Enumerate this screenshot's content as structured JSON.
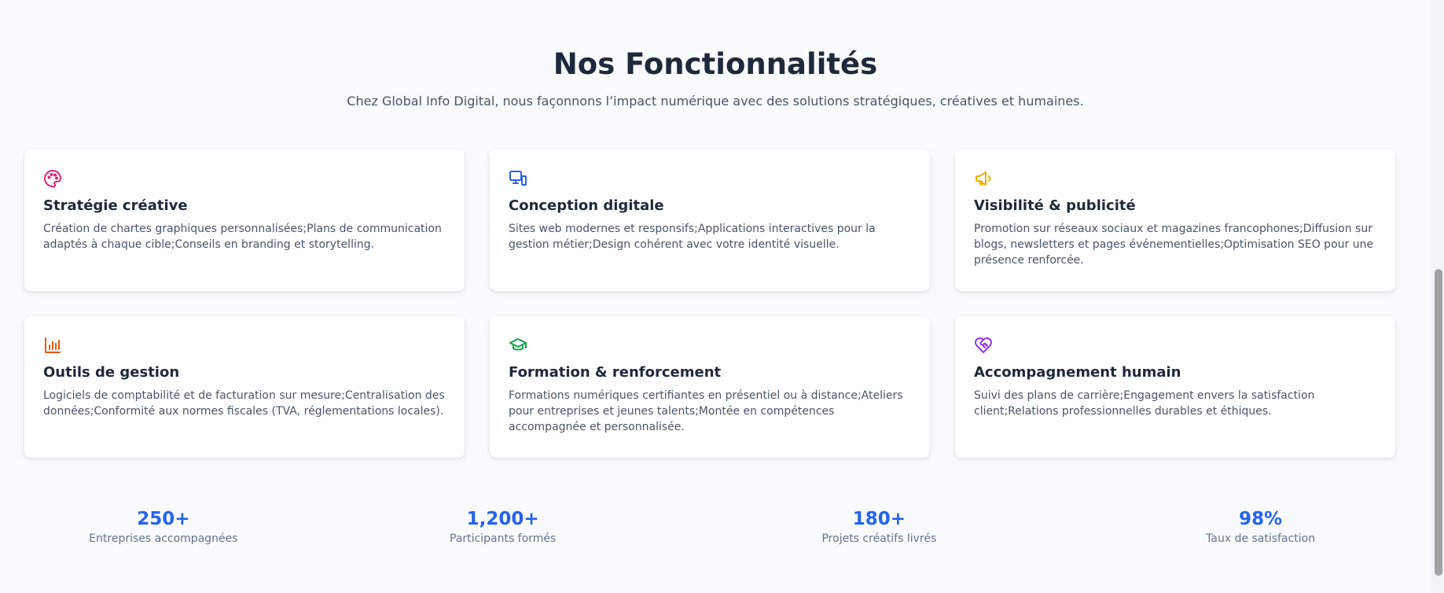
{
  "header": {
    "title": "Nos Fonctionnalités",
    "subtitle": "Chez Global Info Digital, nous façonnons l’impact numérique avec des solutions stratégiques, créatives et humaines."
  },
  "features": [
    {
      "icon": "palette-icon",
      "color": "#db2777",
      "title": "Stratégie créative",
      "description": "Création de chartes graphiques personnalisées;Plans de communication adaptés à chaque cible;Conseils en branding et storytelling."
    },
    {
      "icon": "devices-icon",
      "color": "#2563eb",
      "title": "Conception digitale",
      "description": "Sites web modernes et responsifs;Applications interactives pour la gestion métier;Design cohérent avec votre identité visuelle."
    },
    {
      "icon": "megaphone-icon",
      "color": "#eab308",
      "title": "Visibilité & publicité",
      "description": "Promotion sur réseaux sociaux et magazines francophones;Diffusion sur blogs, newsletters et pages événementielles;Optimisation SEO pour une présence renforcée."
    },
    {
      "icon": "bar-chart-icon",
      "color": "#ea580c",
      "title": "Outils de gestion",
      "description": "Logiciels de comptabilité et de facturation sur mesure;Centralisation des données;Conformité aux normes fiscales (TVA, réglementations locales)."
    },
    {
      "icon": "graduation-cap-icon",
      "color": "#16a34a",
      "title": "Formation & renforcement",
      "description": "Formations numériques certifiantes en présentiel ou à distance;Ateliers pour entreprises et jeunes talents;Montée en compétences accompagnée et personnalisée."
    },
    {
      "icon": "heart-handshake-icon",
      "color": "#9333ea",
      "title": "Accompagnement humain",
      "description": "Suivi des plans de carrière;Engagement envers la satisfaction client;Relations professionnelles durables et éthiques."
    }
  ],
  "stats": [
    {
      "value": "250+",
      "label": "Entreprises accompagnées"
    },
    {
      "value": "1,200+",
      "label": "Participants formés"
    },
    {
      "value": "180+",
      "label": "Projets créatifs livrés"
    },
    {
      "value": "98%",
      "label": "Taux de satisfaction"
    }
  ],
  "colors": {
    "accent": "#2563eb",
    "background": "#f8fafc",
    "heading": "#1e293b",
    "body": "#475569"
  }
}
